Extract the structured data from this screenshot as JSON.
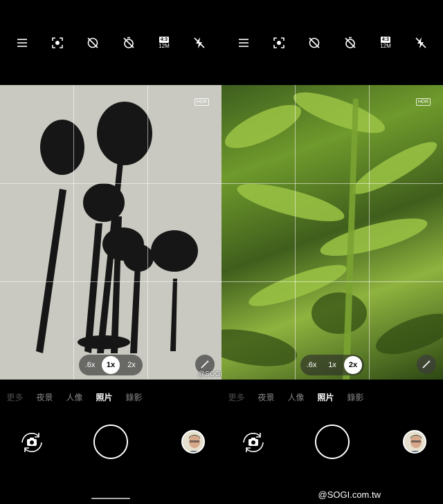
{
  "toolbar_icons": [
    "menu-icon",
    "focus-icon",
    "motion-photo-off-icon",
    "timer-off-icon",
    "aspect-ratio-icon",
    "flash-off-icon"
  ],
  "aspect": {
    "ratio": "4:3",
    "megapixels": "12M"
  },
  "hdr_label": "HDR",
  "zoom_options": [
    ".6x",
    "1x",
    "2x"
  ],
  "left": {
    "active_zoom": "1x"
  },
  "right": {
    "active_zoom": "2x"
  },
  "modes": [
    "更多",
    "夜景",
    "人像",
    "照片",
    "錄影"
  ],
  "active_mode": "照片",
  "watermark_small": "@SOGI.com.tw",
  "watermark_big": "@SOGI.com.tw",
  "colors": {
    "accent": "#ffffff",
    "background": "#000000",
    "inactive_mode": "#888888"
  }
}
